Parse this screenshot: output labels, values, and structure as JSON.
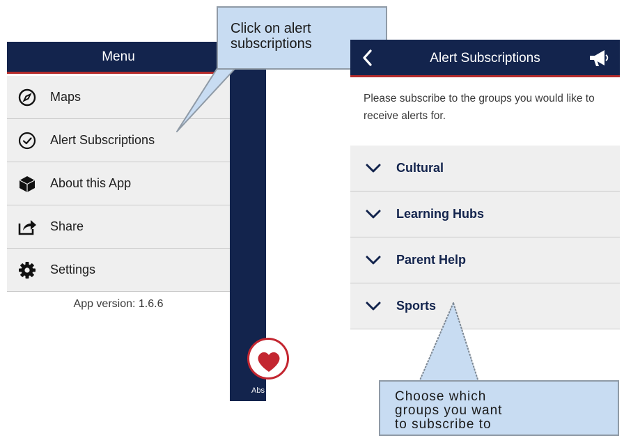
{
  "menu_screen": {
    "header_title": "Menu",
    "items": [
      {
        "label": "Maps",
        "icon": "compass-icon"
      },
      {
        "label": "Alert Subscriptions",
        "icon": "check-circle-icon"
      },
      {
        "label": "About this App",
        "icon": "cube-icon"
      },
      {
        "label": "Share",
        "icon": "share-icon"
      },
      {
        "label": "Settings",
        "icon": "gear-icon"
      }
    ],
    "app_version": "App version: 1.6.6",
    "fab_label": "Abs"
  },
  "callout_top": {
    "line1": "Click on alert",
    "line2": "subscriptions"
  },
  "alert_screen": {
    "header_title": "Alert Subscriptions",
    "intro_text": "Please subscribe to the groups you would like to receive alerts for.",
    "groups": [
      {
        "label": "Cultural"
      },
      {
        "label": "Learning Hubs"
      },
      {
        "label": "Parent Help"
      },
      {
        "label": "Sports"
      }
    ]
  },
  "callout_bottom": {
    "line1": "Choose which",
    "line2": "groups you want",
    "line3": "to subscribe to"
  },
  "colors": {
    "navy": "#13244d",
    "accent_red": "#b42b2b",
    "callout_fill": "#c8dcf2",
    "list_bg": "#efefef"
  }
}
